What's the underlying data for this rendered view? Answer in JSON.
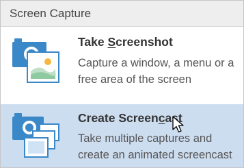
{
  "header": {
    "title": "Screen Capture"
  },
  "items": [
    {
      "title_before": "Take ",
      "title_underlined": "S",
      "title_after": "creenshot",
      "description": "Capture a window, a menu or a free area of the screen",
      "icon": "camera-photo-icon"
    },
    {
      "title_before": "Create Screen",
      "title_underlined": "c",
      "title_after": "ast",
      "description": "Take multiple captures and create an animated screencast",
      "icon": "camera-screencast-icon"
    }
  ],
  "cursor": {
    "icon": "mouse-pointer-icon"
  },
  "colors": {
    "accent": "#3a88c8",
    "hover_background": "#cdddf0",
    "header_background": "#eeeeee"
  }
}
